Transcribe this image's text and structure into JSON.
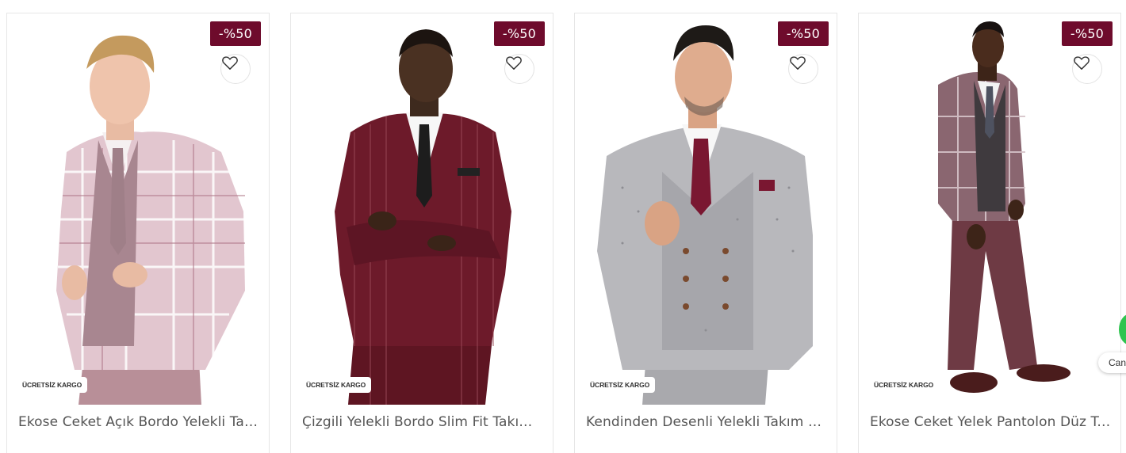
{
  "products": [
    {
      "title": "Ekose Ceket Açık Bordo Yelekli Takım",
      "discount": "-%50",
      "shipping_badge": "ÜCRETSİZ KARGO",
      "image": "light-bordo-plaid-three-piece-suit",
      "favorite_icon": "heart-icon"
    },
    {
      "title": "Çizgili Yelekli Bordo Slim Fit Takım Elbise",
      "discount": "-%50",
      "shipping_badge": "ÜCRETSİZ KARGO",
      "image": "burgundy-pinstripe-slim-fit-suit",
      "favorite_icon": "heart-icon"
    },
    {
      "title": "Kendinden Desenli Yelekli Takım Elbise",
      "discount": "-%50",
      "shipping_badge": "ÜCRETSİZ KARGO",
      "image": "grey-patterned-double-breasted-vest-suit",
      "favorite_icon": "heart-icon"
    },
    {
      "title": "Ekose Ceket Yelek Pantolon Düz Takım",
      "discount": "-%50",
      "shipping_badge": "ÜCRETSİZ KARGO",
      "image": "plaid-jacket-vest-trousers-full-length",
      "favorite_icon": "heart-icon"
    }
  ],
  "chat_widget": {
    "label": "Can",
    "icon": "whatsapp-icon"
  },
  "colors": {
    "discount_badge": "#6e0b2c",
    "title_text": "#555555",
    "card_border": "#e6e6e6"
  }
}
